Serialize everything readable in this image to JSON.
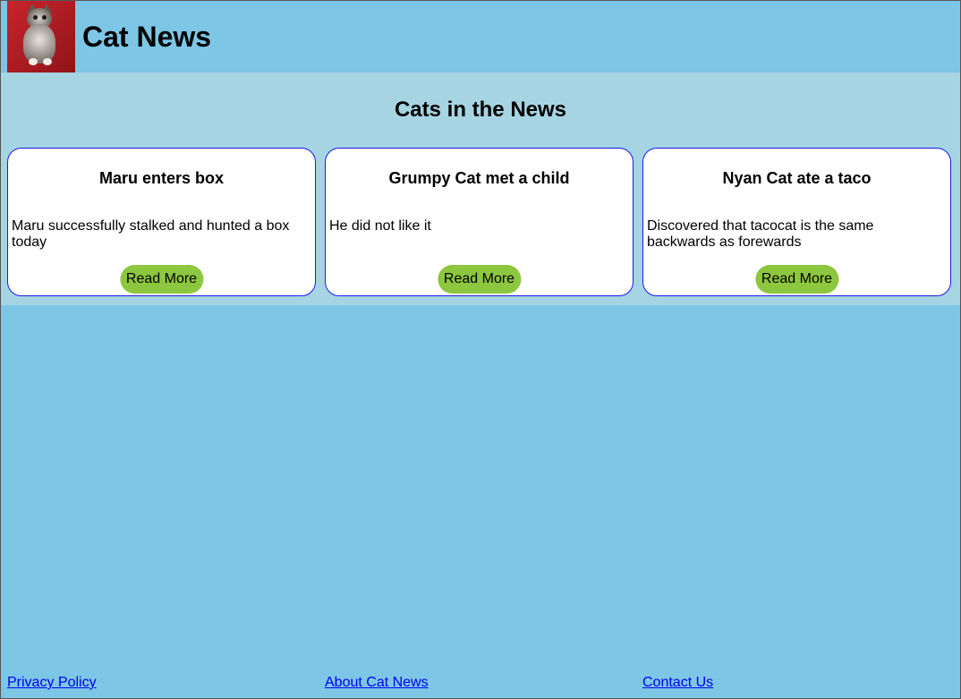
{
  "header": {
    "title": "Cat News",
    "logo_icon": "cat-photo"
  },
  "main": {
    "section_title": "Cats in the News",
    "cards": [
      {
        "title": "Maru enters box",
        "body": "Maru successfully stalked and hunted a box today",
        "button_label": "Read More"
      },
      {
        "title": "Grumpy Cat met a child",
        "body": "He did not like it",
        "button_label": "Read More"
      },
      {
        "title": "Nyan Cat ate a taco",
        "body": "Discovered that tacocat is the same backwards as forewards",
        "button_label": "Read More"
      }
    ]
  },
  "footer": {
    "links": [
      "Privacy Policy",
      "About Cat News",
      "Contact Us"
    ]
  },
  "colors": {
    "page_background": "#7dc6e6",
    "news_band_background": "#a6d4e3",
    "card_border": "#1a1ae6",
    "button_background": "#8dc63f",
    "link": "#0000ee"
  }
}
